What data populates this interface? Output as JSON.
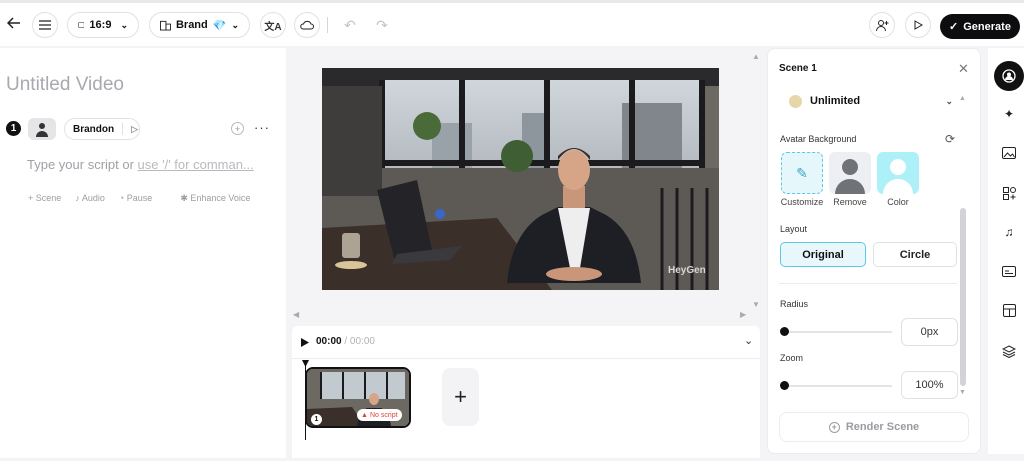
{
  "topbar": {
    "aspect_ratio": "16:9",
    "brand_label": "Brand",
    "brand_emoji": "💎",
    "generate_label": "Generate"
  },
  "script_panel": {
    "video_title": "Untitled Video",
    "scene_number": "1",
    "voice_name": "Brandon",
    "script_placeholder_prefix": "Type your script or ",
    "script_placeholder_link": "use '/' for comman...",
    "actions": [
      "Scene",
      "Audio",
      "Pause",
      "Enhance Voice"
    ]
  },
  "timeline": {
    "current_time": "00:00",
    "total_time": "/ 00:00",
    "scene_badge": "1",
    "warning": "No script"
  },
  "properties": {
    "scene_title": "Scene 1",
    "plan": "Unlimited",
    "avatar_background_label": "Avatar Background",
    "bg_options": [
      "Customize",
      "Remove",
      "Color"
    ],
    "layout_label": "Layout",
    "layout_options": [
      "Original",
      "Circle"
    ],
    "selected_layout": "Original",
    "radius_label": "Radius",
    "radius_value": "0px",
    "zoom_label": "Zoom",
    "zoom_value": "100%",
    "render_label": "Render Scene"
  },
  "watermark": "HeyGen",
  "colors": {
    "accent": "#5bc8e8",
    "selected_bg": "#e8f7fc",
    "warning": "#e0433a"
  },
  "rail_icons": [
    "avatar-icon",
    "magic-icon",
    "image-icon",
    "elements-icon",
    "music-icon",
    "caption-icon",
    "layout-icon",
    "layers-icon"
  ]
}
